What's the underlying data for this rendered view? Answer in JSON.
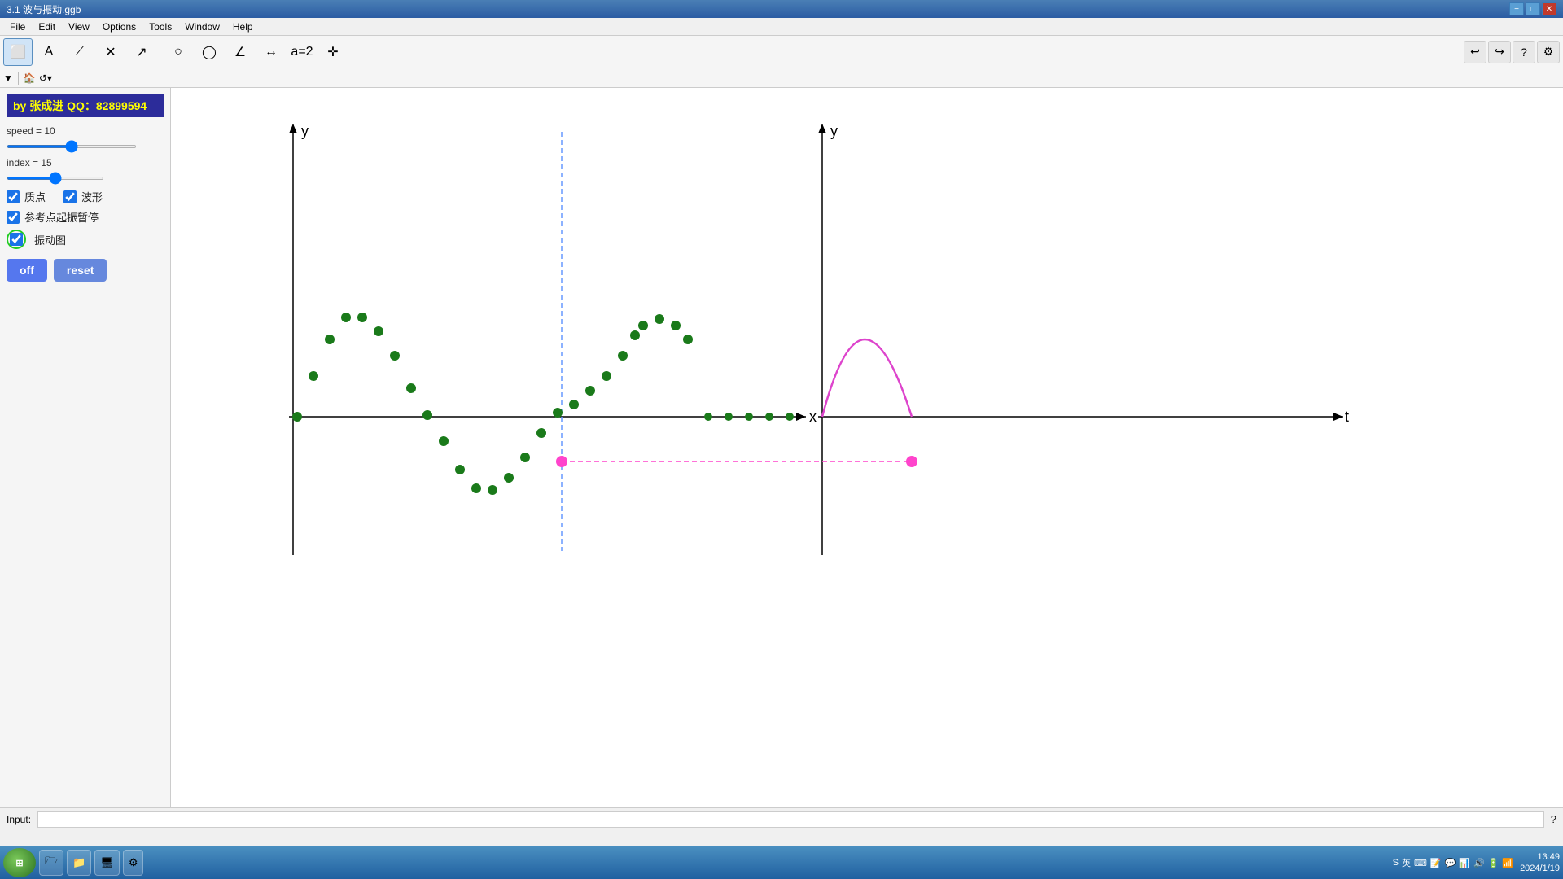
{
  "titlebar": {
    "title": "3.1 波与振动.ggb",
    "minimize": "−",
    "maximize": "□",
    "close": "✕"
  },
  "menubar": {
    "items": [
      "File",
      "Edit",
      "View",
      "Options",
      "Tools",
      "Window",
      "Help"
    ]
  },
  "author": {
    "label": "by  张成进    QQ：82899594"
  },
  "speed_slider": {
    "label": "speed = 10",
    "value": 10,
    "min": 0,
    "max": 20
  },
  "index_slider": {
    "label": "index = 15",
    "value": 15,
    "min": 0,
    "max": 30
  },
  "checkboxes": [
    {
      "id": "cb1",
      "label": "质点",
      "checked": true
    },
    {
      "id": "cb2",
      "label": "波形",
      "checked": true
    },
    {
      "id": "cb3",
      "label": "参考点起振暂停",
      "checked": true
    },
    {
      "id": "cb4",
      "label": "振动图",
      "checked": true
    }
  ],
  "buttons": {
    "off": "off",
    "reset": "reset"
  },
  "axes": {
    "left_x": "x",
    "left_y": "y",
    "right_x": "t",
    "right_y": "y"
  },
  "inputbar": {
    "label": "Input:",
    "placeholder": ""
  },
  "taskbar": {
    "time": "13:49",
    "date": "2024/1/19"
  },
  "status_right": {
    "lang": "英",
    "icons": [
      "S",
      "英"
    ]
  }
}
